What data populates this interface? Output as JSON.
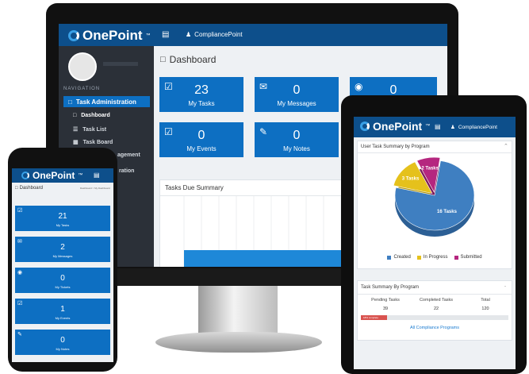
{
  "brand": {
    "name": "OnePoint",
    "tm": "™"
  },
  "user": "CompliancePoint",
  "colors": {
    "primary": "#0d6fc2",
    "topbar": "#0d4f8b",
    "sidebar": "#2b3038",
    "created": "#3f7fc1",
    "in_progress": "#e5c11c",
    "submitted": "#b5267f",
    "progress_red": "#d9534f"
  },
  "desktop": {
    "sidebar": {
      "nav_heading": "NAVIGATION",
      "items": [
        {
          "label": "Task Administration",
          "icon": "monitor-icon"
        },
        {
          "label": "Dashboard",
          "icon": "monitor-icon"
        },
        {
          "label": "Task List",
          "icon": "list-icon"
        },
        {
          "label": "Task Board",
          "icon": "board-icon"
        },
        {
          "label": "agement"
        },
        {
          "label": "ration"
        }
      ]
    },
    "page_title": "Dashboard",
    "tiles": [
      {
        "value": "23",
        "label": "My Tasks",
        "icon": "checkbox-icon"
      },
      {
        "value": "0",
        "label": "My Messages",
        "icon": "envelope-icon"
      },
      {
        "value": "0",
        "label": "",
        "icon": "lifebuoy-icon"
      },
      {
        "value": "0",
        "label": "My Events",
        "icon": "calendar-check-icon"
      },
      {
        "value": "0",
        "label": "My Notes",
        "icon": "notebook-icon"
      }
    ],
    "tasks_due_title": "Tasks Due Summary"
  },
  "phone": {
    "page_title": "Dashboard",
    "breadcrumb": "Dashboard > My Dashboard",
    "tiles": [
      {
        "value": "21",
        "label": "My Tasks"
      },
      {
        "value": "2",
        "label": "My Messages"
      },
      {
        "value": "0",
        "label": "My Tickets"
      },
      {
        "value": "1",
        "label": "My Events"
      },
      {
        "value": "0",
        "label": "My Notes"
      }
    ]
  },
  "tablet": {
    "summary_title": "User Task Summary by Program",
    "chart_data": {
      "type": "pie",
      "categories": [
        "Created",
        "In Progress",
        "Submitted"
      ],
      "values": [
        16,
        3,
        2
      ],
      "data_labels": [
        "16 Tasks",
        "3 Tasks",
        "2 Tasks"
      ],
      "legend_position": "bottom"
    },
    "program_title": "Task Summary By Program",
    "columns": [
      "Pending Tasks",
      "Completed Tasks",
      "Total"
    ],
    "row": [
      "39",
      "22",
      "120"
    ],
    "progress": {
      "label": "18% complete",
      "fraction": 0.18
    },
    "link": "All Compliance Programs"
  }
}
